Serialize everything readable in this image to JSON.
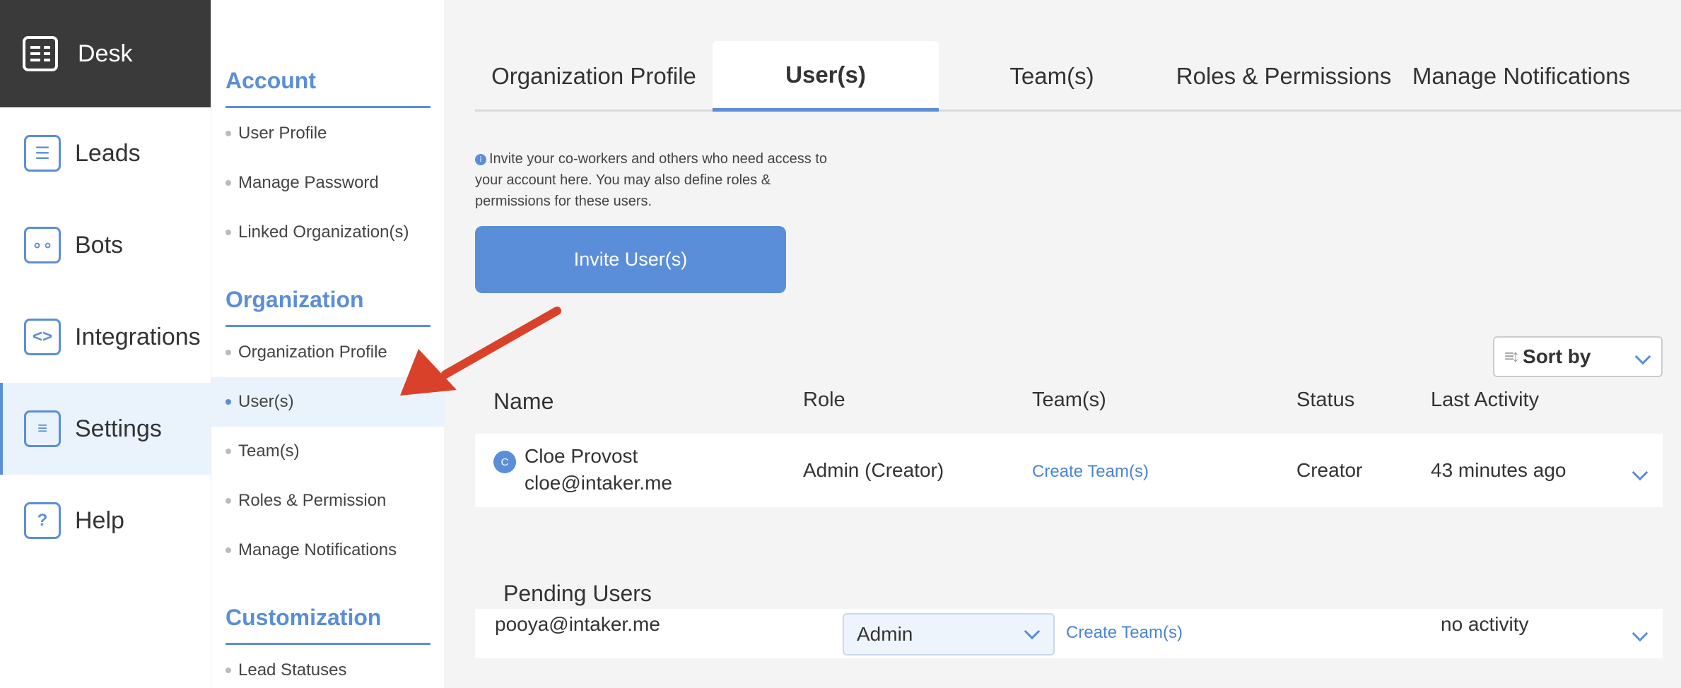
{
  "nav": {
    "brand": "Desk",
    "items": [
      {
        "label": "Leads",
        "icon": "user-card-icon"
      },
      {
        "label": "Bots",
        "icon": "robot-icon"
      },
      {
        "label": "Integrations",
        "icon": "code-brackets-icon"
      },
      {
        "label": "Settings",
        "icon": "sliders-icon"
      },
      {
        "label": "Help",
        "icon": "question-icon"
      }
    ]
  },
  "subnav": {
    "account_title": "Account",
    "account_items": [
      "User Profile",
      "Manage Password",
      "Linked Organization(s)"
    ],
    "org_title": "Organization",
    "org_items": [
      "Organization Profile",
      "User(s)",
      "Team(s)",
      "Roles & Permission",
      "Manage Notifications"
    ],
    "custom_title": "Customization",
    "custom_items": [
      "Lead Statuses"
    ]
  },
  "tabs": [
    "Organization Profile",
    "User(s)",
    "Team(s)",
    "Roles & Permissions",
    "Manage Notifications"
  ],
  "info_text": "Invite your co-workers and others who need access to your account here. You may also define roles & permissions for these users.",
  "invite_label": "Invite User(s)",
  "sort_label": "Sort by",
  "columns": {
    "name": "Name",
    "role": "Role",
    "teams": "Team(s)",
    "status": "Status",
    "last_activity": "Last Activity"
  },
  "users": [
    {
      "initial": "C",
      "name": "Cloe Provost",
      "email": "cloe@intaker.me",
      "role": "Admin (Creator)",
      "team_action": "Create Team(s)",
      "status": "Creator",
      "last_activity": "43 minutes ago"
    }
  ],
  "pending_title": "Pending Users",
  "pending": [
    {
      "email": "pooya@intaker.me",
      "role": "Admin",
      "team_action": "Create Team(s)",
      "last_activity": "no activity"
    }
  ],
  "colors": {
    "accent": "#5b8ed8",
    "brand_bg": "#3a3a3a",
    "arrow": "#d9412b"
  }
}
